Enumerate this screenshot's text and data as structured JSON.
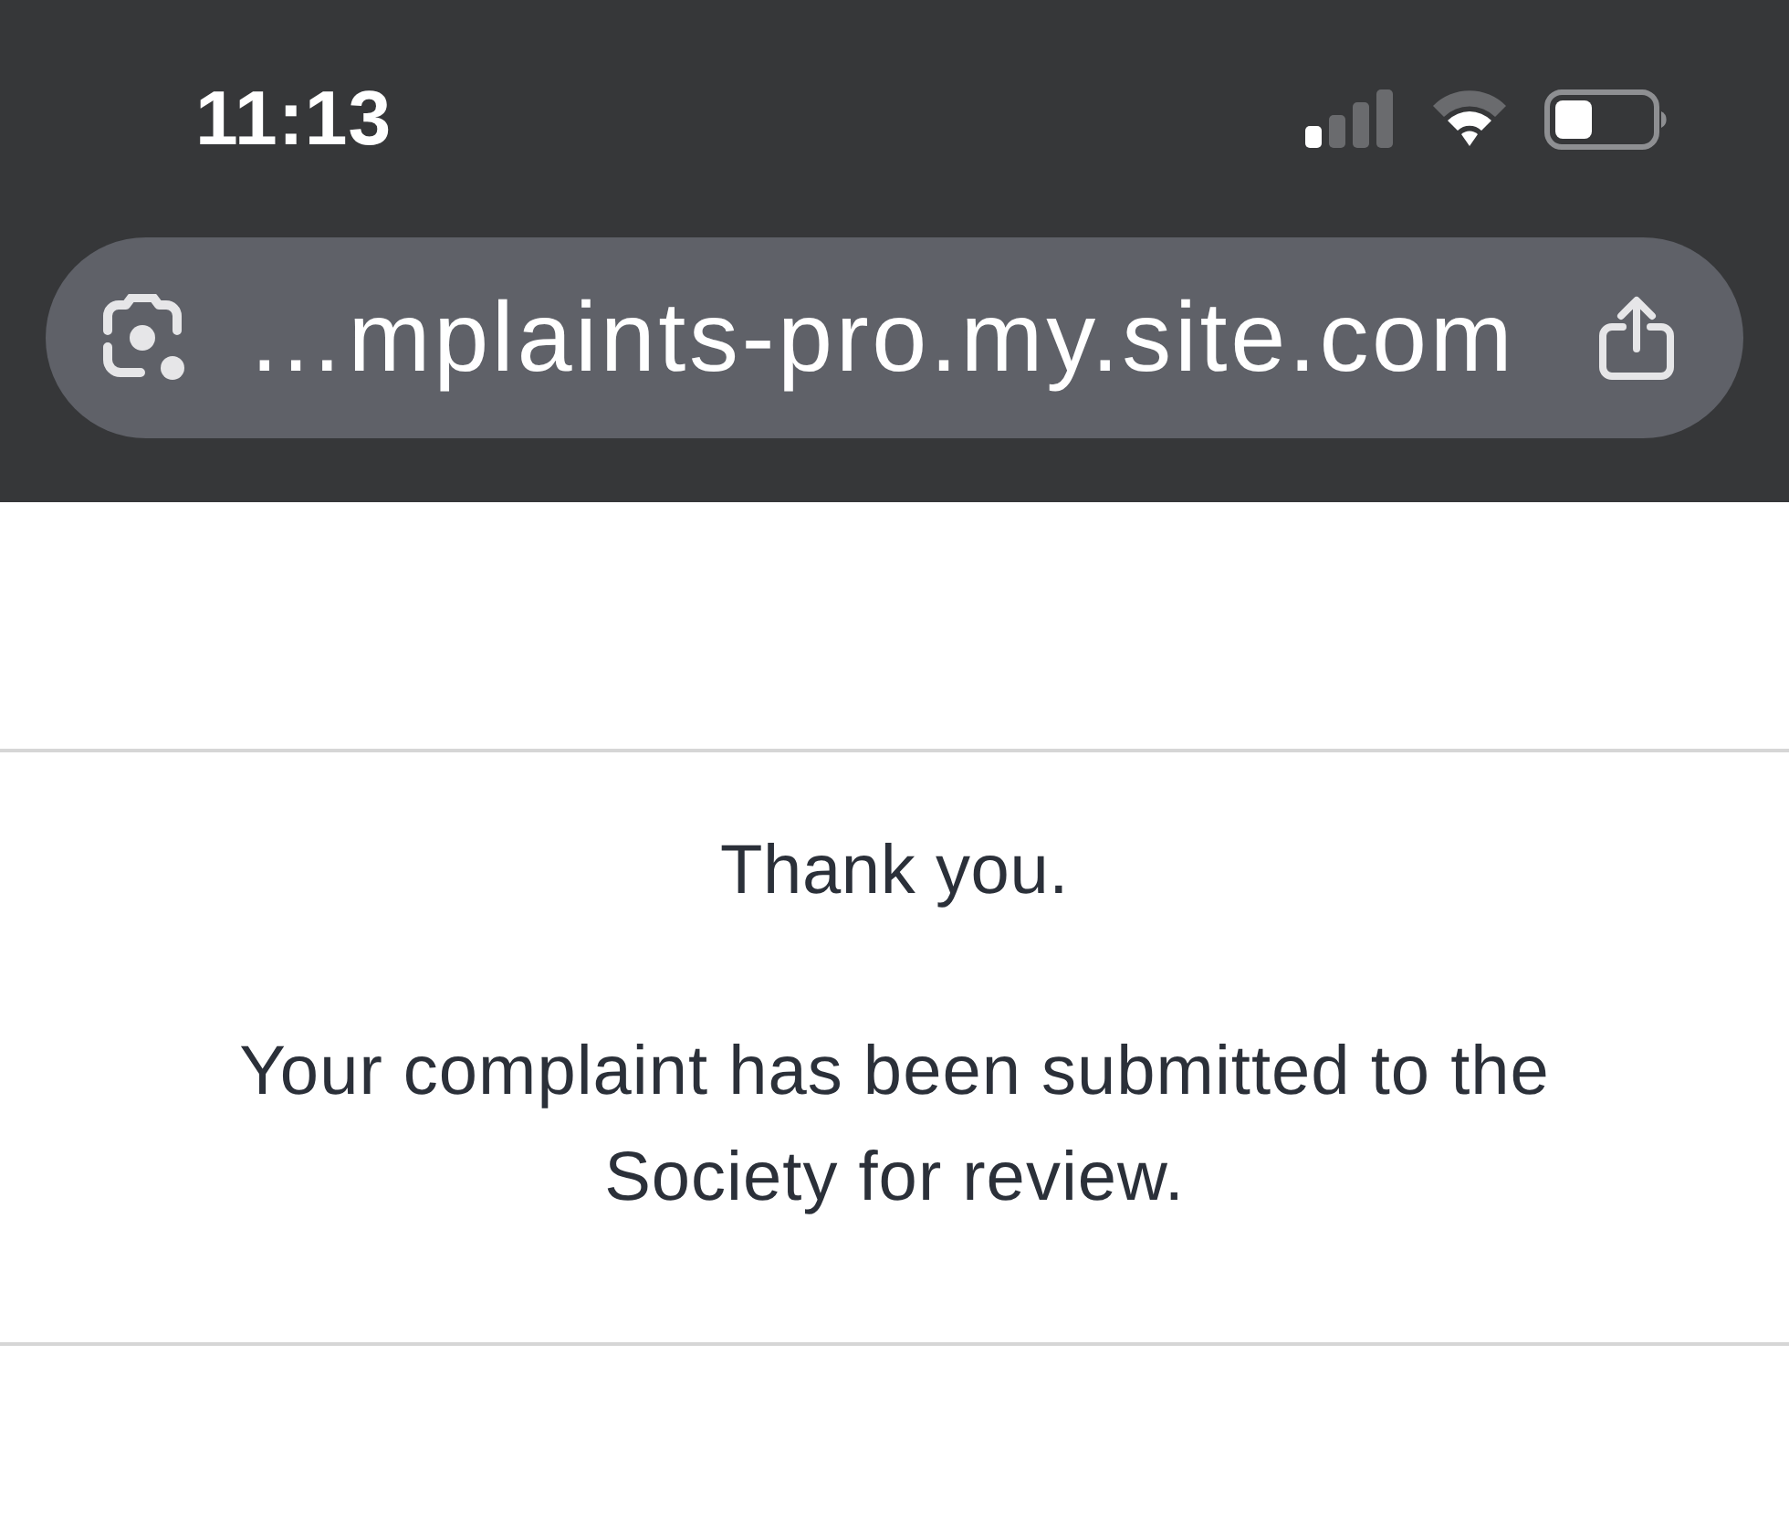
{
  "status_bar": {
    "time": "11:13"
  },
  "address_bar": {
    "url": "…mplaints-pro.my.site.com"
  },
  "message": {
    "title": "Thank you.",
    "body": "Your complaint has been submitted to the Society for review."
  }
}
